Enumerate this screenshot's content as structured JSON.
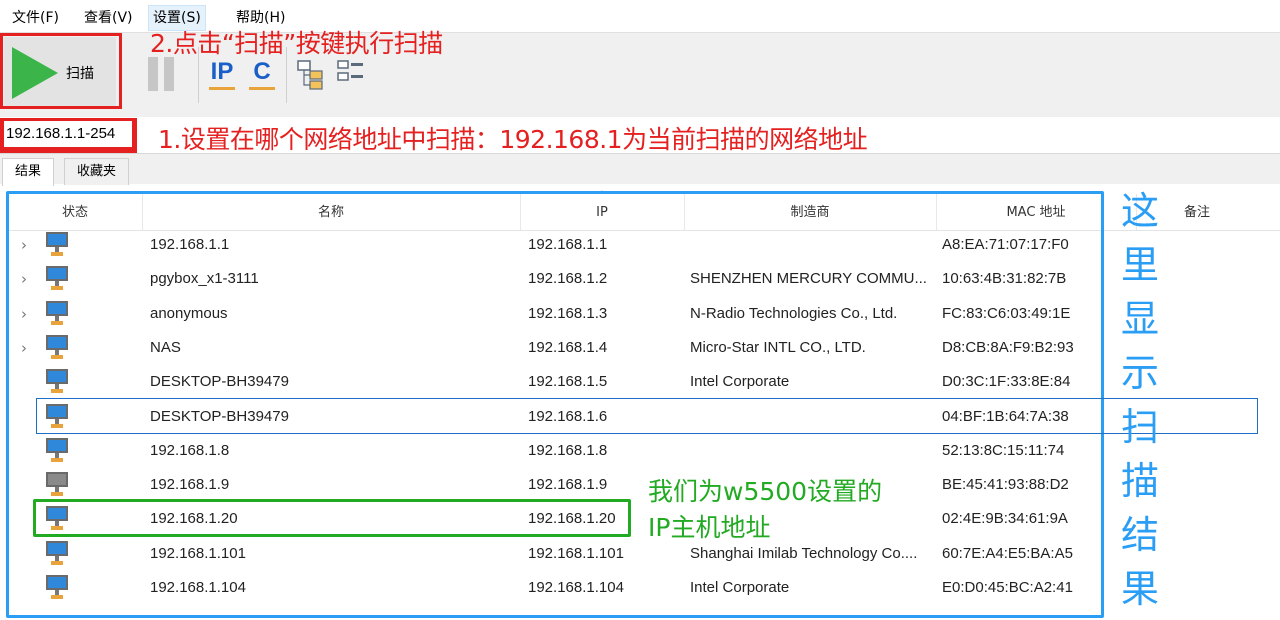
{
  "menu": [
    {
      "label": "文件(F)"
    },
    {
      "label": "查看(V)"
    },
    {
      "label": "设置(S)"
    },
    {
      "label": "帮助(H)"
    }
  ],
  "toolbar": {
    "scan_label": "扫描",
    "ip_glyph": "IP",
    "c_glyph": "C"
  },
  "address": {
    "value": "192.168.1.1-254"
  },
  "tabs": [
    {
      "label": "结果"
    },
    {
      "label": "收藏夹"
    }
  ],
  "table": {
    "headers": {
      "status": "状态",
      "name": "名称",
      "ip": "IP",
      "vendor": "制造商",
      "mac": "MAC 地址",
      "notes": "备注"
    },
    "rows": [
      {
        "name": "192.168.1.1",
        "ip": "192.168.1.1",
        "vendor": "",
        "mac": "A8:EA:71:07:17:F0",
        "expandable": true,
        "online": true
      },
      {
        "name": "pgybox_x1-3111",
        "ip": "192.168.1.2",
        "vendor": "SHENZHEN MERCURY COMMU...",
        "mac": "10:63:4B:31:82:7B",
        "expandable": true,
        "online": true
      },
      {
        "name": "anonymous",
        "ip": "192.168.1.3",
        "vendor": "N-Radio Technologies Co., Ltd.",
        "mac": "FC:83:C6:03:49:1E",
        "expandable": true,
        "online": true
      },
      {
        "name": "NAS",
        "ip": "192.168.1.4",
        "vendor": "Micro-Star INTL CO., LTD.",
        "mac": "D8:CB:8A:F9:B2:93",
        "expandable": true,
        "online": true
      },
      {
        "name": "DESKTOP-BH39479",
        "ip": "192.168.1.5",
        "vendor": "Intel Corporate",
        "mac": "D0:3C:1F:33:8E:84",
        "expandable": false,
        "online": true
      },
      {
        "name": "DESKTOP-BH39479",
        "ip": "192.168.1.6",
        "vendor": "",
        "mac": "04:BF:1B:64:7A:38",
        "expandable": false,
        "online": true
      },
      {
        "name": "192.168.1.8",
        "ip": "192.168.1.8",
        "vendor": "",
        "mac": "52:13:8C:15:11:74",
        "expandable": false,
        "online": true
      },
      {
        "name": "192.168.1.9",
        "ip": "192.168.1.9",
        "vendor": "",
        "mac": "BE:45:41:93:88:D2",
        "expandable": false,
        "online": false
      },
      {
        "name": "192.168.1.20",
        "ip": "192.168.1.20",
        "vendor": "",
        "mac": "02:4E:9B:34:61:9A",
        "expandable": false,
        "online": true
      },
      {
        "name": "192.168.1.101",
        "ip": "192.168.1.101",
        "vendor": "Shanghai Imilab Technology Co....",
        "mac": "60:7E:A4:E5:BA:A5",
        "expandable": false,
        "online": true
      },
      {
        "name": "192.168.1.104",
        "ip": "192.168.1.104",
        "vendor": "Intel Corporate",
        "mac": "E0:D0:45:BC:A2:41",
        "expandable": false,
        "online": true
      }
    ]
  },
  "annotations": {
    "step2": "2.点击“扫描”按键执行扫描",
    "step1": "1.设置在哪个网络地址中扫描：192.168.1为当前扫描的网络地址",
    "green_line1": "我们为w5500设置的",
    "green_line2": "IP主机地址",
    "blue_chars": [
      "这",
      "里",
      "显",
      "示",
      "扫",
      "描",
      "结",
      "果"
    ]
  },
  "colors": {
    "annotation_red": "#e52020",
    "annotation_blue": "#2a9df4",
    "annotation_green": "#22aa22",
    "scan_green": "#3bb54a",
    "accent_orange": "#e8a33a"
  }
}
